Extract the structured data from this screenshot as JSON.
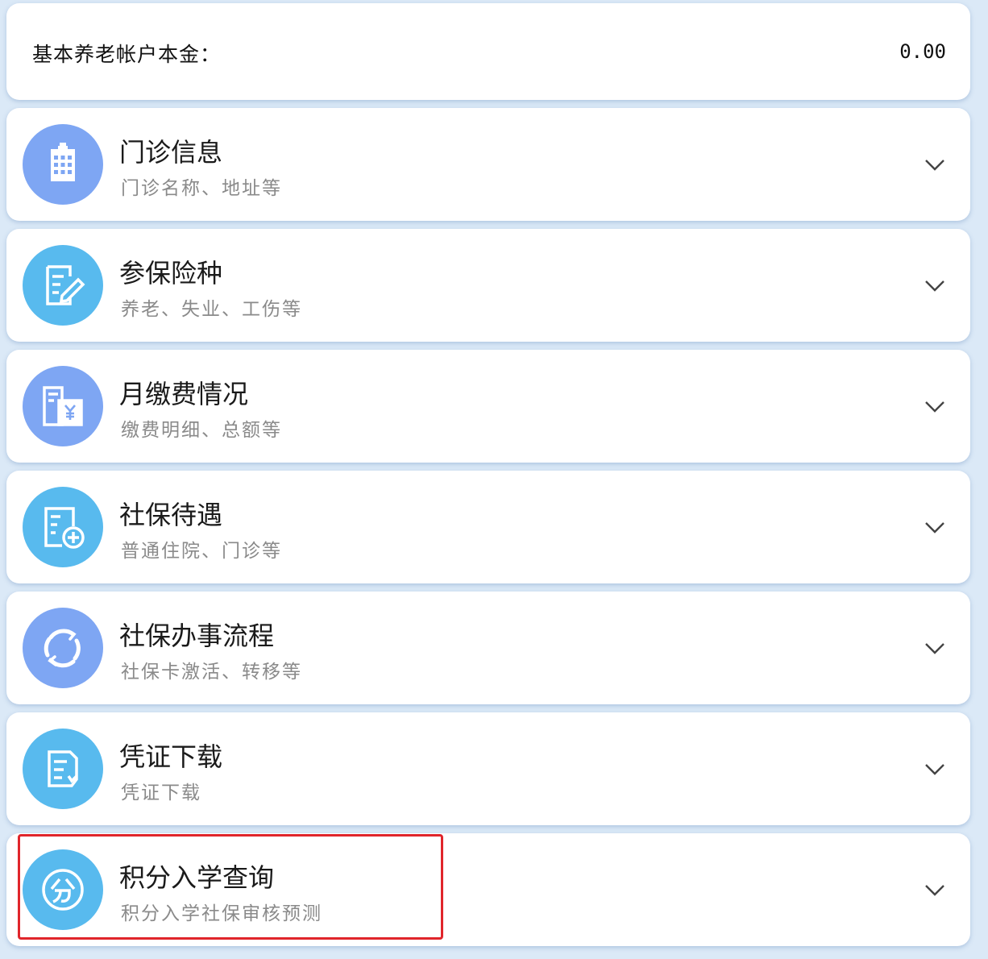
{
  "balance": {
    "label": "基本养老帐户本金：",
    "value": "0.00"
  },
  "accent": {
    "blue": "#7aa3f2",
    "cyan": "#56b8ee",
    "highlight": "#e0252b"
  },
  "items": [
    {
      "title": "门诊信息",
      "subtitle": "门诊名称、地址等",
      "icon": "hospital-icon",
      "color": "#7ea6f3"
    },
    {
      "title": "参保险种",
      "subtitle": "养老、失业、工伤等",
      "icon": "document-edit-icon",
      "color": "#58baee"
    },
    {
      "title": "月缴费情况",
      "subtitle": "缴费明细、总额等",
      "icon": "payment-bill-icon",
      "color": "#7ea6f3"
    },
    {
      "title": "社保待遇",
      "subtitle": "普通住院、门诊等",
      "icon": "benefit-form-icon",
      "color": "#58baee"
    },
    {
      "title": "社保办事流程",
      "subtitle": "社保卡激活、转移等",
      "icon": "process-cycle-icon",
      "color": "#7ea6f3"
    },
    {
      "title": "凭证下载",
      "subtitle": "凭证下载",
      "icon": "voucher-icon",
      "color": "#58baee"
    },
    {
      "title": "积分入学查询",
      "subtitle": "积分入学社保审核预测",
      "icon": "points-icon",
      "color": "#58baee"
    }
  ]
}
